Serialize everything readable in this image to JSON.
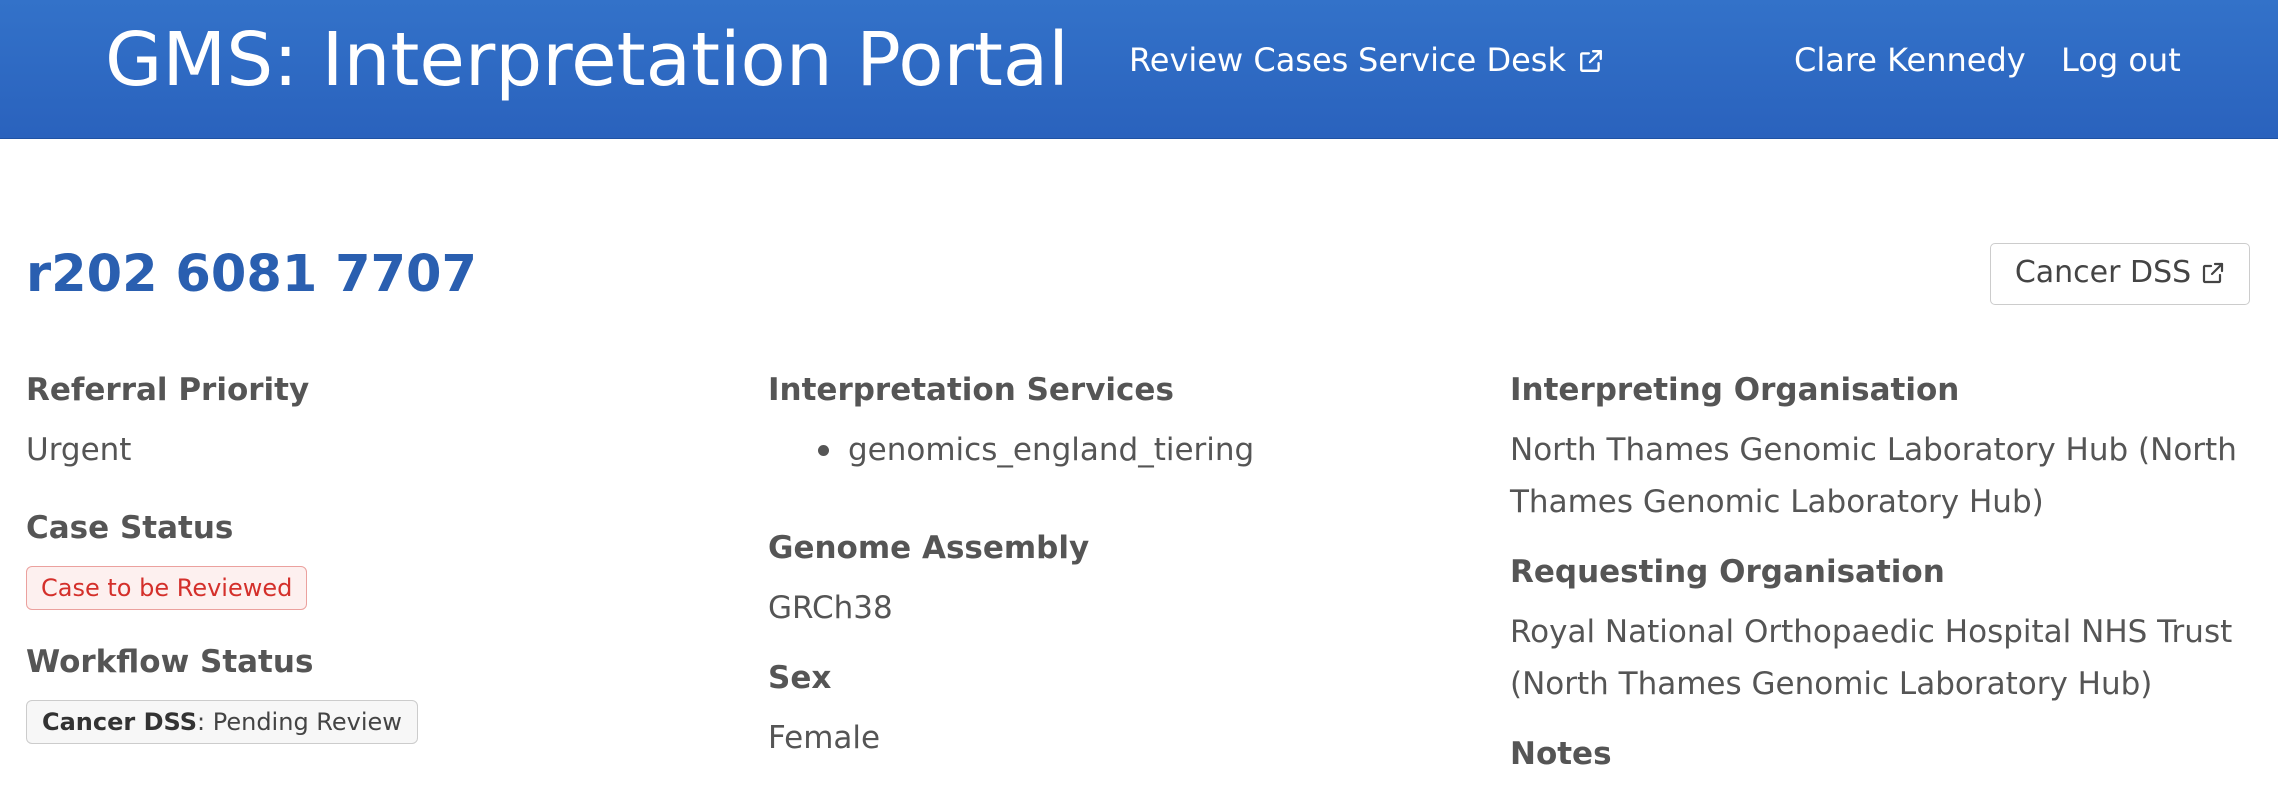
{
  "header": {
    "brand": "GMS: Interpretation Portal",
    "nav": {
      "review_cases": "Review Cases",
      "service_desk": "Service Desk",
      "user_name": "Clare Kennedy",
      "log_out": "Log out"
    }
  },
  "case": {
    "title": "r202 6081 7707",
    "cancer_dss_button": "Cancer DSS"
  },
  "details": {
    "referral_priority": {
      "label": "Referral Priority",
      "value": "Urgent"
    },
    "case_status": {
      "label": "Case Status",
      "value": "Case to be Reviewed"
    },
    "workflow_status": {
      "label": "Workflow Status",
      "system": "Cancer DSS",
      "value": ": Pending Review"
    },
    "interpretation_services": {
      "label": "Interpretation Services",
      "items": [
        "genomics_england_tiering"
      ]
    },
    "genome_assembly": {
      "label": "Genome Assembly",
      "value": "GRCh38"
    },
    "sex": {
      "label": "Sex",
      "value": "Female"
    },
    "interpreting_organisation": {
      "label": "Interpreting Organisation",
      "line1": "North Thames Genomic Laboratory Hub (North",
      "line2": "Thames Genomic Laboratory Hub)"
    },
    "requesting_organisation": {
      "label": "Requesting Organisation",
      "line1": "Royal National Orthopaedic Hospital NHS Trust",
      "line2": "(North Thames Genomic Laboratory Hub)"
    },
    "notes": {
      "label": "Notes"
    }
  },
  "icons": {
    "service_desk": "external-link-icon",
    "cancer_dss": "external-link-icon"
  },
  "colors": {
    "header_bg": "#2f6ac4",
    "title": "#2a5fb0",
    "status_red": "#d4302b"
  }
}
